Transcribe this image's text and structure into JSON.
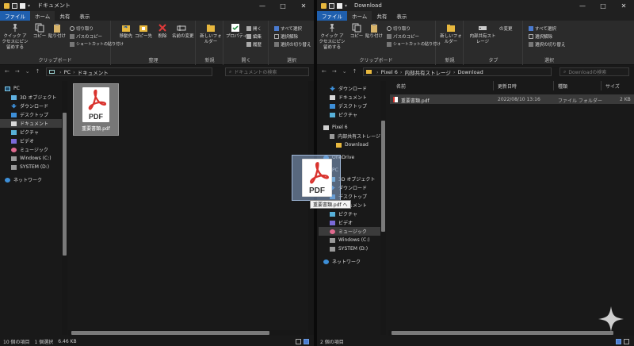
{
  "colors": {
    "accent": "#1f5fae",
    "folder": "#e8b83e",
    "pdf_red": "#d9332e",
    "selection": "#3b3b3b"
  },
  "left": {
    "title": "ドキュメント",
    "window_controls": [
      "—",
      "□",
      "✕"
    ],
    "tabs": [
      "ファイル",
      "ホーム",
      "共有",
      "表示"
    ],
    "ribbon": {
      "pin_label": "クイック アクセスにピン留めする",
      "copy_label": "コピー",
      "paste_label": "貼り付け",
      "cut_label": "切り取り",
      "copy_path_label": "パスのコピー",
      "paste_shortcut_label": "ショートカットの貼り付け",
      "clipboard_group": "クリップボード",
      "move_to_label": "移動先",
      "copy_to_label": "コピー先",
      "delete_label": "削除",
      "rename_label": "名前の変更",
      "organize_group": "整理",
      "new_folder_label": "新しいフォルダー",
      "new_group": "新規",
      "properties_label": "プロパティ",
      "open_label": "開く",
      "edit_label": "編集",
      "history_label": "履歴",
      "open_group": "開く",
      "select_all_label": "すべて選択",
      "select_none_label": "選択解除",
      "invert_selection_label": "選択の切り替え",
      "select_group": "選択"
    },
    "address": {
      "nav_back": "←",
      "nav_forward": "→",
      "nav_recent": "⌄",
      "nav_up": "↑",
      "path": [
        "PC",
        "ドキュメント"
      ],
      "search_placeholder": "ドキュメントの検索"
    },
    "nav_items": [
      {
        "label": "PC",
        "icon": "pc-icon"
      },
      {
        "label": "3D オブジェクト",
        "icon": "3d-objects-icon"
      },
      {
        "label": "ダウンロード",
        "icon": "download-icon"
      },
      {
        "label": "デスクトップ",
        "icon": "desktop-icon"
      },
      {
        "label": "ドキュメント",
        "icon": "documents-icon"
      },
      {
        "label": "ピクチャ",
        "icon": "pictures-icon"
      },
      {
        "label": "ビデオ",
        "icon": "video-icon"
      },
      {
        "label": "ミュージック",
        "icon": "music-icon"
      },
      {
        "label": "Windows (C:)",
        "icon": "drive-icon"
      },
      {
        "label": "SYSTEM (D:)",
        "icon": "drive-icon"
      },
      {
        "label": "ネットワーク",
        "icon": "network-icon"
      }
    ],
    "file": {
      "name": "重要書類.pdf",
      "badge": "PDF"
    },
    "status": {
      "count": "10 個の項目",
      "selected": "1 個選択",
      "size": "6.46 KB"
    }
  },
  "right": {
    "title": "Download",
    "window_controls": [
      "—",
      "□",
      "✕"
    ],
    "tabs": [
      "ファイル",
      "ホーム",
      "共有",
      "表示"
    ],
    "ribbon": {
      "pin_label": "クイック アクセスにピン留めする",
      "copy_label": "コピー",
      "paste_label": "貼り付け",
      "cut_label": "切り取り",
      "copy_path_label": "パスのコピー",
      "paste_shortcut_label": "ショートカットの貼り付け",
      "clipboard_group": "クリップボード",
      "new_folder_label": "新しいフォルダー",
      "new_group": "新規",
      "storage_label": "内部共有ストレージ",
      "change_label": "の変更",
      "extra_group": "タブ",
      "select_all_label": "すべて選択",
      "select_none_label": "選択解除",
      "invert_selection_label": "選択の切り替え",
      "select_group": "選択"
    },
    "address": {
      "nav_back": "←",
      "nav_forward": "→",
      "nav_recent": "⌄",
      "nav_up": "↑",
      "path": [
        "Pixel 6",
        "内部共有ストレージ",
        "Download"
      ],
      "search_placeholder": "Downloadの検索"
    },
    "nav_items": [
      {
        "label": "ダウンロード",
        "icon": "download-icon"
      },
      {
        "label": "ドキュメント",
        "icon": "documents-icon"
      },
      {
        "label": "デスクトップ",
        "icon": "desktop-icon"
      },
      {
        "label": "ピクチャ",
        "icon": "pictures-icon"
      },
      {
        "label": "Pixel 6",
        "icon": "phone-icon"
      },
      {
        "label": "内部共有ストレージ",
        "icon": "storage-icon"
      },
      {
        "label": "Download",
        "icon": "folder-icon"
      },
      {
        "label": "OneDrive",
        "icon": "onedrive-icon"
      },
      {
        "label": "PC",
        "icon": "pc-icon"
      },
      {
        "label": "3D オブジェクト",
        "icon": "3d-objects-icon"
      },
      {
        "label": "ダウンロード",
        "icon": "download-icon"
      },
      {
        "label": "デスクトップ",
        "icon": "desktop-icon"
      },
      {
        "label": "ドキュメント",
        "icon": "documents-icon"
      },
      {
        "label": "ピクチャ",
        "icon": "pictures-icon"
      },
      {
        "label": "ビデオ",
        "icon": "video-icon"
      },
      {
        "label": "ミュージック",
        "icon": "music-icon"
      },
      {
        "label": "Windows (C:)",
        "icon": "drive-icon"
      },
      {
        "label": "SYSTEM (D:)",
        "icon": "drive-icon"
      },
      {
        "label": "ネットワーク",
        "icon": "network-icon"
      }
    ],
    "columns": [
      "名前",
      "更新日時",
      "種類",
      "サイズ"
    ],
    "rows": [
      {
        "name": "重要書類.pdf",
        "date": "2022/08/10 13:16",
        "type": "ファイル フォルダー",
        "size": "2 KB"
      }
    ],
    "status": {
      "count": "2 個の項目"
    }
  },
  "drag": {
    "badge": "PDF",
    "tooltip": "重要書類.pdf へ"
  }
}
